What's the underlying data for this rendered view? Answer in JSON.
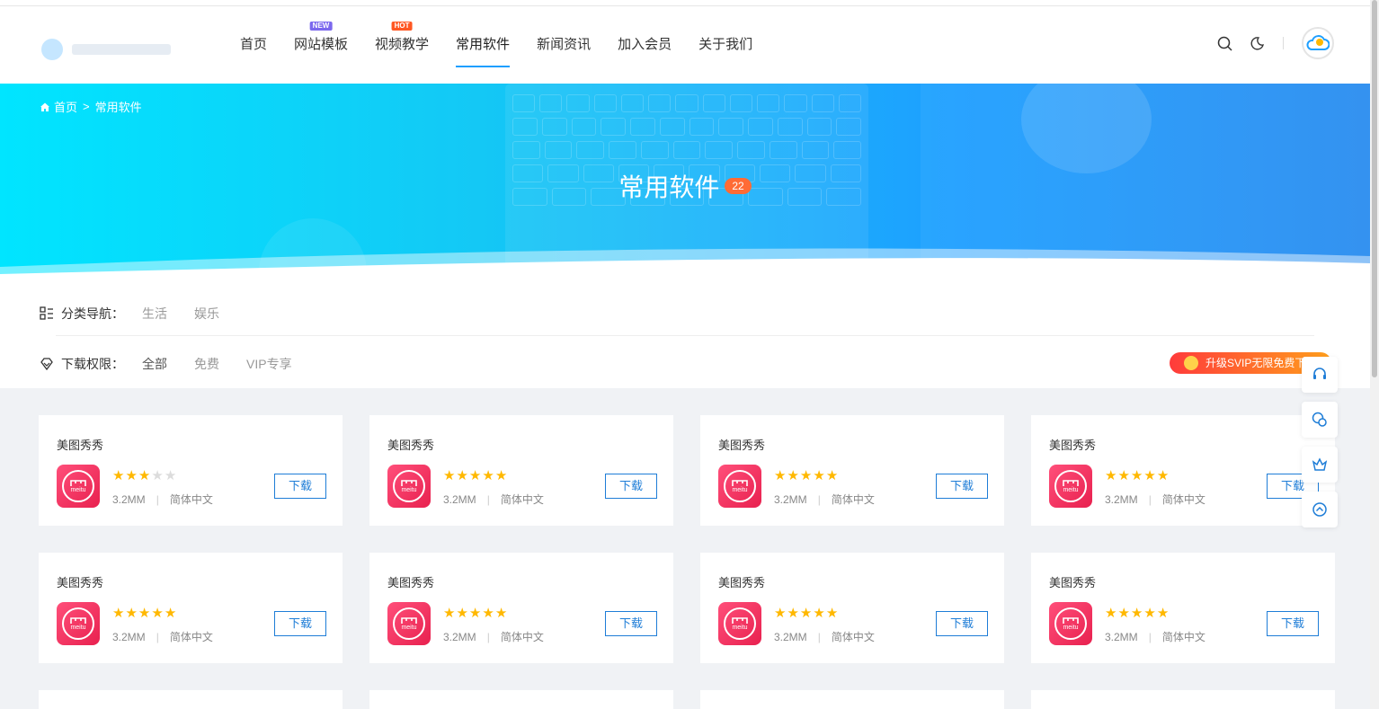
{
  "nav": {
    "items": [
      {
        "label": "首页",
        "badge": ""
      },
      {
        "label": "网站模板",
        "badge": "NEW"
      },
      {
        "label": "视频教学",
        "badge": "HOT"
      },
      {
        "label": "常用软件",
        "badge": "",
        "active": true
      },
      {
        "label": "新闻资讯",
        "badge": ""
      },
      {
        "label": "加入会员",
        "badge": ""
      },
      {
        "label": "关于我们",
        "badge": ""
      }
    ],
    "icons": [
      "search-icon",
      "moon-icon",
      "avatar"
    ]
  },
  "banner": {
    "breadcrumb_home": "首页",
    "breadcrumb_sep": ">",
    "breadcrumb_current": "常用软件",
    "title": "常用软件",
    "count": "22"
  },
  "filters": {
    "category_label": "分类导航：",
    "categories": [
      "生活",
      "娱乐"
    ],
    "permission_label": "下载权限：",
    "permissions": [
      "全部",
      "免费",
      "VIP专享"
    ],
    "svip_button": "升级SVIP无限免费下载"
  },
  "cards": [
    {
      "name": "美图秀秀",
      "rating": 3,
      "size": "3.2MM",
      "lang": "简体中文",
      "button": "下载",
      "icon_text": "meitu"
    },
    {
      "name": "美图秀秀",
      "rating": 5,
      "size": "3.2MM",
      "lang": "简体中文",
      "button": "下载",
      "icon_text": "meitu"
    },
    {
      "name": "美图秀秀",
      "rating": 5,
      "size": "3.2MM",
      "lang": "简体中文",
      "button": "下载",
      "icon_text": "meitu"
    },
    {
      "name": "美图秀秀",
      "rating": 5,
      "size": "3.2MM",
      "lang": "简体中文",
      "button": "下载",
      "icon_text": "meitu"
    },
    {
      "name": "美图秀秀",
      "rating": 5,
      "size": "3.2MM",
      "lang": "简体中文",
      "button": "下载",
      "icon_text": "meitu"
    },
    {
      "name": "美图秀秀",
      "rating": 5,
      "size": "3.2MM",
      "lang": "简体中文",
      "button": "下载",
      "icon_text": "meitu"
    },
    {
      "name": "美图秀秀",
      "rating": 5,
      "size": "3.2MM",
      "lang": "简体中文",
      "button": "下载",
      "icon_text": "meitu"
    },
    {
      "name": "美图秀秀",
      "rating": 5,
      "size": "3.2MM",
      "lang": "简体中文",
      "button": "下载",
      "icon_text": "meitu"
    }
  ],
  "float_buttons": [
    "headset-icon",
    "chat-icon",
    "vip-crown-icon",
    "back-to-top-icon"
  ],
  "colors": {
    "accent": "#1e9fff",
    "button": "#1e7dd7",
    "star": "#ffb800",
    "badge_count": "#ff6b35",
    "svip_start": "#ff3b3b",
    "svip_end": "#ff9f1c"
  }
}
